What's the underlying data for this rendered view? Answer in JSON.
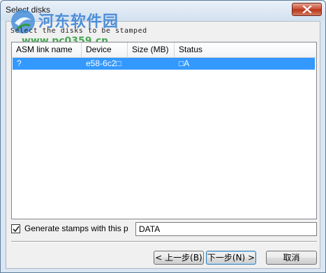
{
  "window": {
    "title": "Select disks"
  },
  "watermark": {
    "text_cn": "河东软件园",
    "url": "www.pc0359.cn"
  },
  "subtitle": "Select the disks to be stamped",
  "table": {
    "columns": [
      "ASM link name",
      "Device",
      "Size (MB)",
      "Status"
    ],
    "rows": [
      {
        "asm_link_name": "?",
        "device": "e58-6c2□",
        "size_mb": "",
        "status": "□A",
        "selected": true
      }
    ]
  },
  "stamp_option": {
    "checked": true,
    "label": "Generate stamps with this p",
    "value": "DATA"
  },
  "buttons": {
    "back": "< 上一步(B)",
    "next": "下一步(N) >",
    "cancel": "取消"
  },
  "colors": {
    "selection": "#3399ff",
    "close_button": "#c7472e"
  }
}
